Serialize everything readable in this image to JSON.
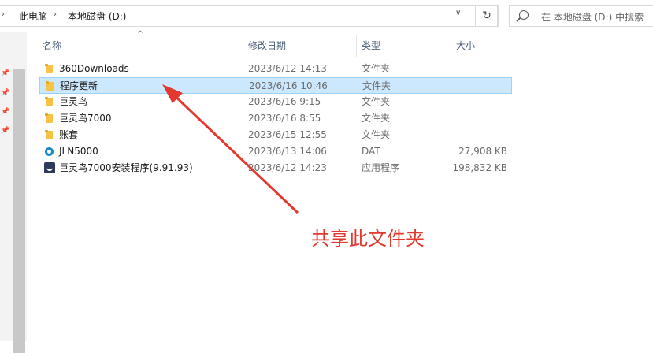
{
  "address_bar": {
    "breadcrumb": [
      "此电脑",
      "本地磁盘 (D:)"
    ],
    "search_placeholder": "在 本地磁盘 (D:) 中搜索"
  },
  "columns": {
    "name": "名称",
    "date": "修改日期",
    "type": "类型",
    "size": "大小"
  },
  "files": [
    {
      "name": "360Downloads",
      "date": "2023/6/12 14:13",
      "type": "文件夹",
      "size": "",
      "icon": "folder-icon",
      "selected": false
    },
    {
      "name": "程序更新",
      "date": "2023/6/16 10:46",
      "type": "文件夹",
      "size": "",
      "icon": "folder-icon",
      "selected": true
    },
    {
      "name": "巨灵鸟",
      "date": "2023/6/16 9:15",
      "type": "文件夹",
      "size": "",
      "icon": "folder-icon",
      "selected": false
    },
    {
      "name": "巨灵鸟7000",
      "date": "2023/6/16 8:55",
      "type": "文件夹",
      "size": "",
      "icon": "folder-icon",
      "selected": false
    },
    {
      "name": "账套",
      "date": "2023/6/15 12:55",
      "type": "文件夹",
      "size": "",
      "icon": "folder-icon",
      "selected": false
    },
    {
      "name": "JLN5000",
      "date": "2023/6/13 14:06",
      "type": "DAT",
      "size": "27,908 KB",
      "icon": "dat-file-icon",
      "selected": false
    },
    {
      "name": "巨灵鸟7000安装程序(9.91.93)",
      "date": "2023/6/12 14:23",
      "type": "应用程序",
      "size": "198,832 KB",
      "icon": "app-icon",
      "selected": false
    }
  ],
  "annotation": {
    "text": "共享此文件夹",
    "color": "#e2382e"
  },
  "colors": {
    "selection_bg": "#cce8ff",
    "selection_border": "#99d1ff",
    "folder": "#f6c344",
    "header_text": "#4c607a"
  }
}
